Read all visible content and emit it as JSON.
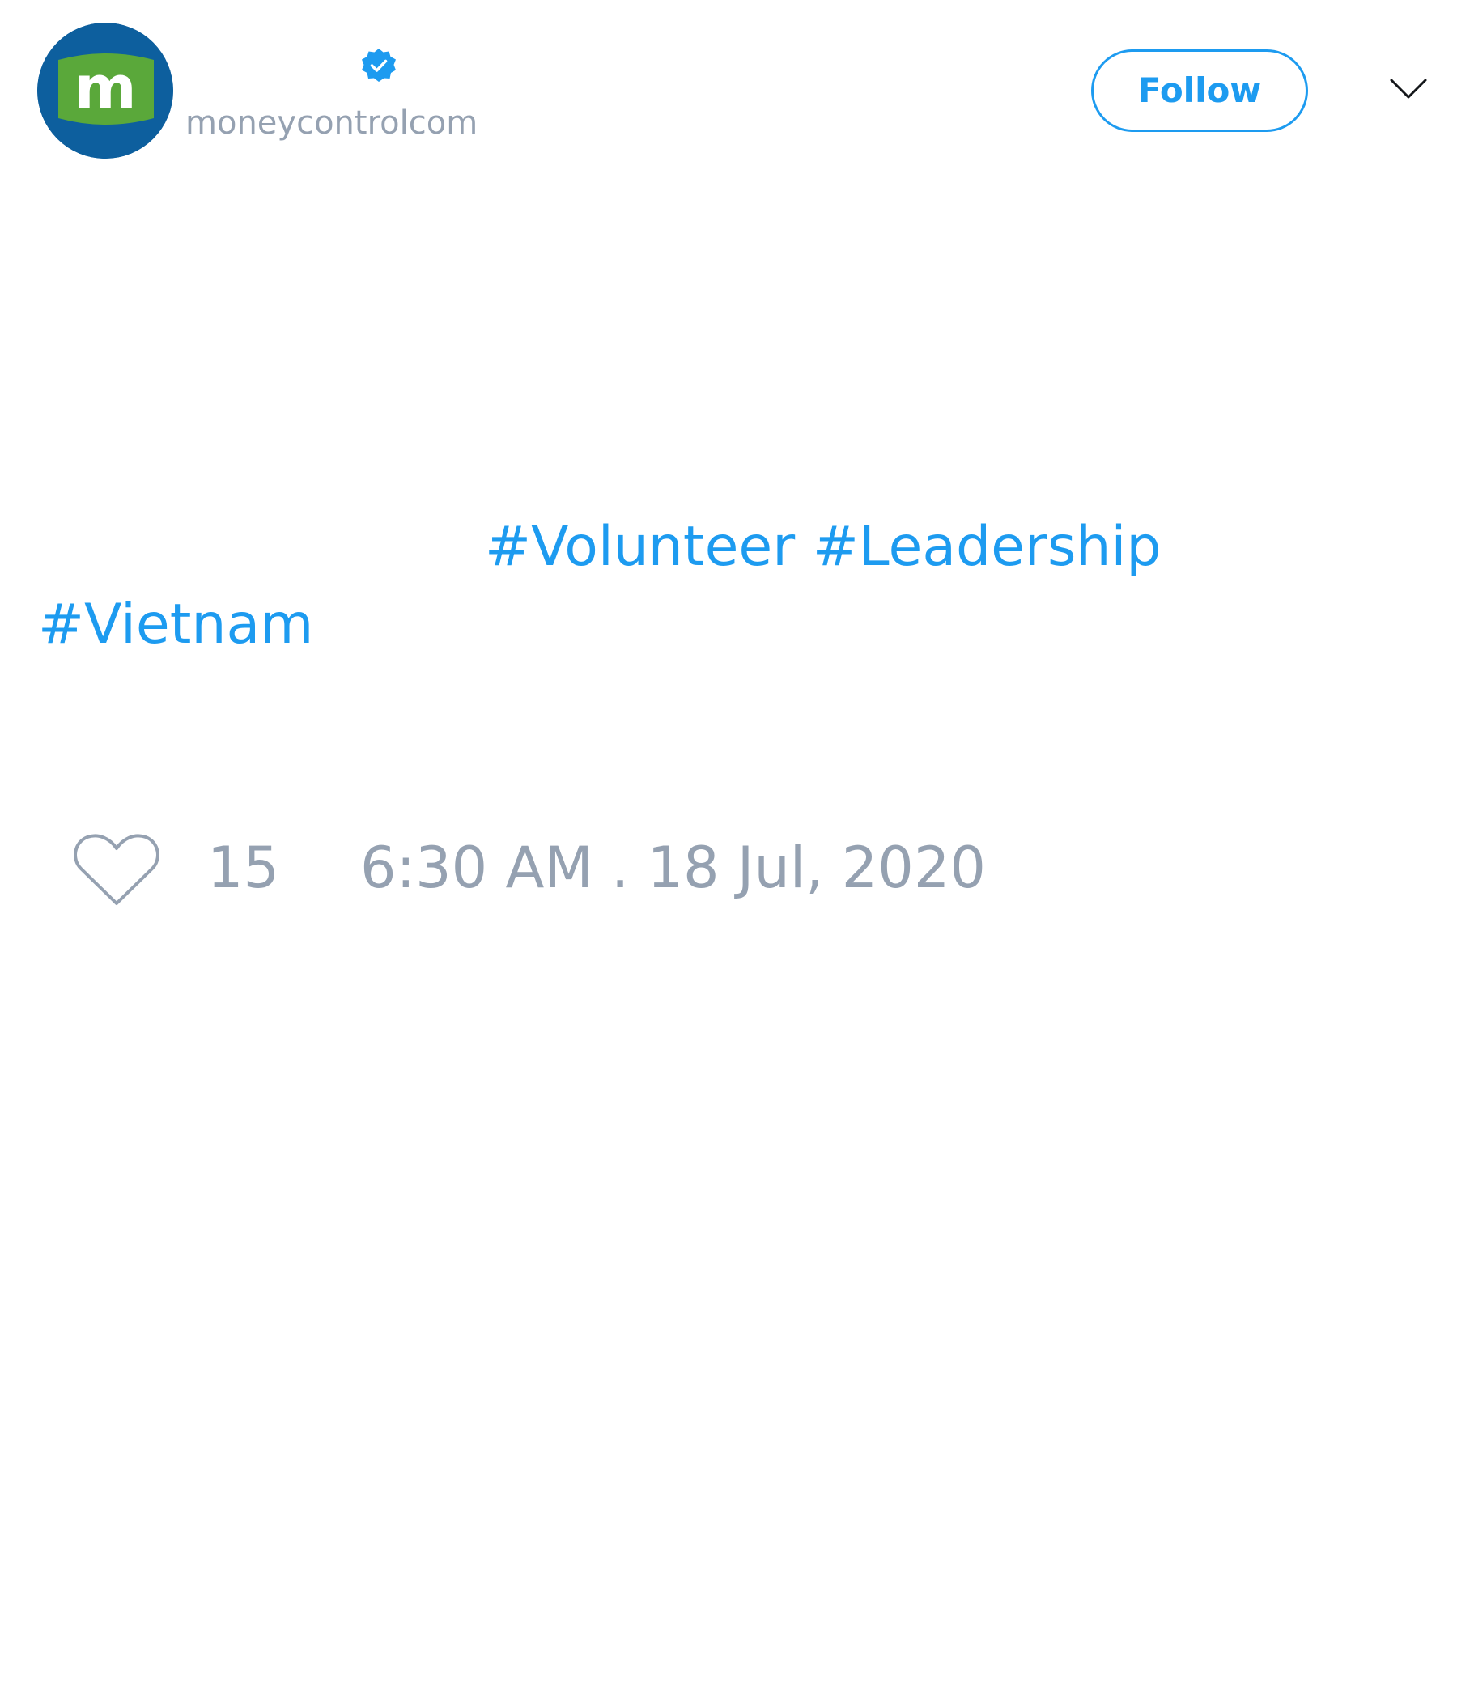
{
  "header": {
    "display_name": "",
    "handle": "moneycontrolcom",
    "follow_label": "Follow",
    "avatar_letter": "m",
    "verified": true
  },
  "tweet": {
    "text_leading": "",
    "hashtags": [
      "#Volunteer",
      "#Leadership",
      "#Vietnam"
    ]
  },
  "footer": {
    "like_count": "15",
    "timestamp": "6:30 AM . 18 Jul, 2020"
  },
  "icons": {
    "avatar": "moneycontrol-logo-icon",
    "verified": "verified-badge-icon",
    "menu": "chevron-down-icon",
    "like": "heart-outline-icon"
  },
  "colors": {
    "accent": "#1d9bf0",
    "muted_text": "#95a1b1",
    "avatar_bg": "#0d5f9e",
    "logo_green": "#5aa83a"
  }
}
